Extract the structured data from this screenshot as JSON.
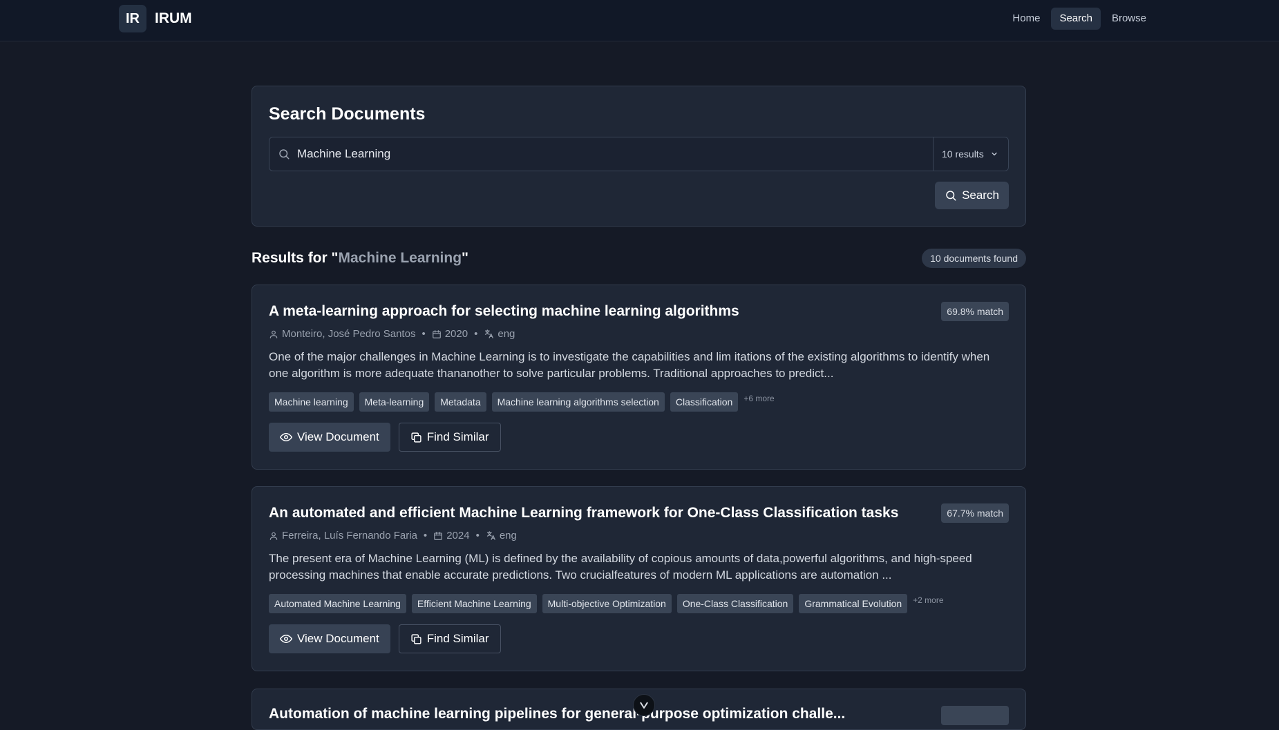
{
  "header": {
    "logo": "IR",
    "brand": "IRUM",
    "nav": [
      {
        "label": "Home",
        "active": false
      },
      {
        "label": "Search",
        "active": true
      },
      {
        "label": "Browse",
        "active": false
      }
    ]
  },
  "search": {
    "title": "Search Documents",
    "query": "Machine Learning",
    "results_select": "10 results",
    "button_label": "Search"
  },
  "results": {
    "heading_prefix": "Results for \"",
    "heading_query": "Machine Learning",
    "heading_suffix": "\"",
    "count_label": "10 documents found",
    "items": [
      {
        "title": "A meta-learning approach for selecting machine learning algorithms",
        "match": "69.8% match",
        "author": "Monteiro, José Pedro Santos",
        "year": "2020",
        "lang": "eng",
        "abstract": "One of the major challenges in Machine Learning is to investigate the capabilities and lim itations of the existing algorithms to identify when one algorithm is more adequate thananother to solve particular problems. Traditional approaches to predict...",
        "tags": [
          "Machine learning",
          "Meta-learning",
          "Metadata",
          "Machine learning algorithms selection",
          "Classification"
        ],
        "more": "+6 more",
        "view_label": "View Document",
        "similar_label": "Find Similar"
      },
      {
        "title": "An automated and efficient Machine Learning framework for One-Class Classification tasks",
        "match": "67.7% match",
        "author": "Ferreira, Luís Fernando Faria",
        "year": "2024",
        "lang": "eng",
        "abstract": "The present era of Machine Learning (ML) is defined by the availability of copious amounts of data,powerful algorithms, and high-speed processing machines that enable accurate predictions. Two crucialfeatures of modern ML applications are automation ...",
        "tags": [
          "Automated Machine Learning",
          "Efficient Machine Learning",
          "Multi-objective Optimization",
          "One-Class Classification",
          "Grammatical Evolution"
        ],
        "more": "+2 more",
        "view_label": "View Document",
        "similar_label": "Find Similar"
      }
    ],
    "peek_title": "Automation of machine learning pipelines for general-purpose optimization challe..."
  }
}
